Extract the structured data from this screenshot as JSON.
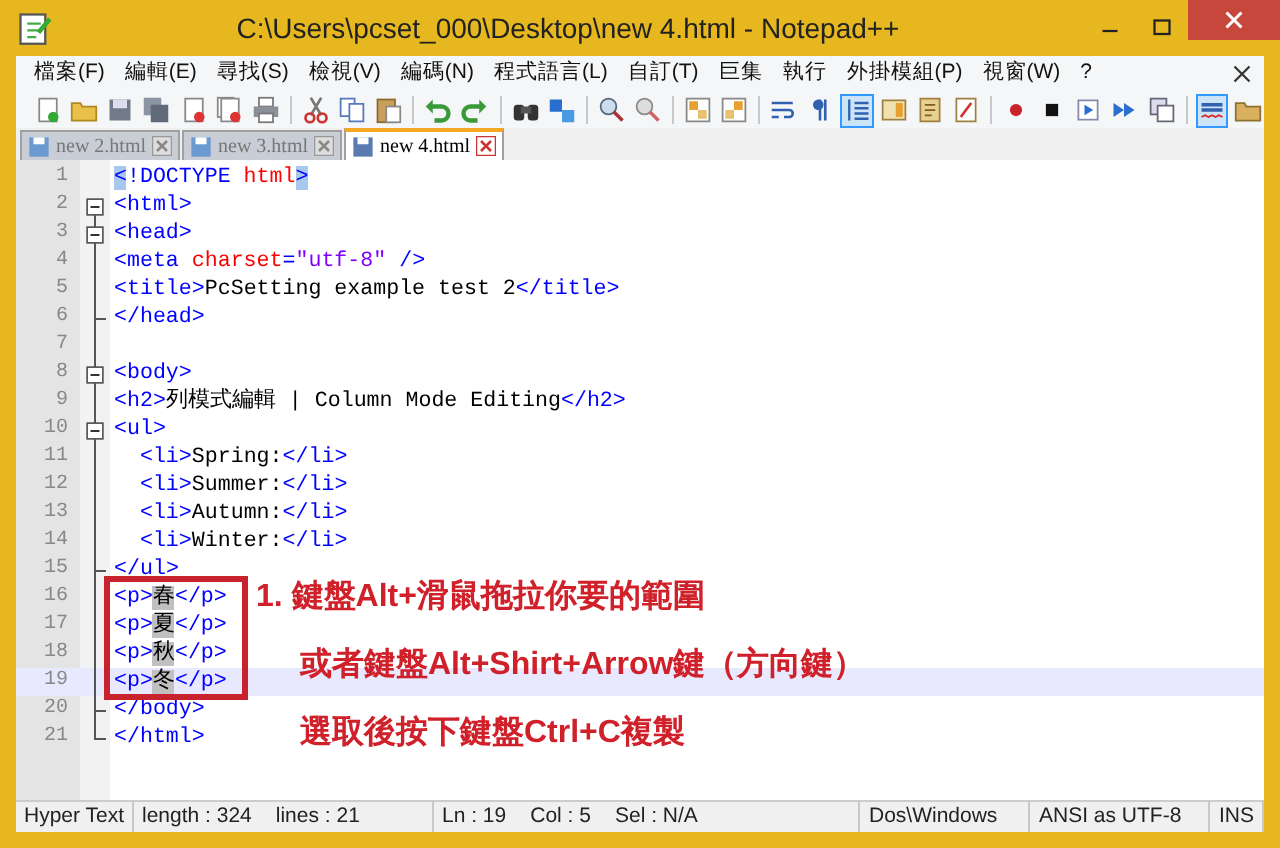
{
  "window": {
    "title": "C:\\Users\\pcset_000\\Desktop\\new  4.html - Notepad++"
  },
  "menu": [
    "檔案(F)",
    "編輯(E)",
    "尋找(S)",
    "檢視(V)",
    "編碼(N)",
    "程式語言(L)",
    "自訂(T)",
    "巨集",
    "執行",
    "外掛模組(P)",
    "視窗(W)",
    "?"
  ],
  "toolbar": [
    {
      "kind": "new",
      "pressed": false
    },
    {
      "kind": "open",
      "pressed": false
    },
    {
      "kind": "save",
      "pressed": false
    },
    {
      "kind": "saveall",
      "pressed": false
    },
    {
      "kind": "close",
      "pressed": false
    },
    {
      "kind": "closeall",
      "pressed": false
    },
    {
      "kind": "print",
      "pressed": false
    },
    {
      "kind": "sep"
    },
    {
      "kind": "cut",
      "pressed": false
    },
    {
      "kind": "copy",
      "pressed": false
    },
    {
      "kind": "paste",
      "pressed": false
    },
    {
      "kind": "sep"
    },
    {
      "kind": "undo",
      "pressed": false
    },
    {
      "kind": "redo",
      "pressed": false
    },
    {
      "kind": "sep"
    },
    {
      "kind": "find",
      "pressed": false
    },
    {
      "kind": "replace",
      "pressed": false
    },
    {
      "kind": "sep"
    },
    {
      "kind": "zoomin",
      "pressed": false
    },
    {
      "kind": "zoomout",
      "pressed": false
    },
    {
      "kind": "sep"
    },
    {
      "kind": "syncv",
      "pressed": false
    },
    {
      "kind": "synch",
      "pressed": false
    },
    {
      "kind": "sep"
    },
    {
      "kind": "wrap",
      "pressed": false
    },
    {
      "kind": "para",
      "pressed": false
    },
    {
      "kind": "indent",
      "pressed": true
    },
    {
      "kind": "docmap",
      "pressed": false
    },
    {
      "kind": "udl",
      "pressed": false
    },
    {
      "kind": "funclist",
      "pressed": false
    },
    {
      "kind": "sep"
    },
    {
      "kind": "record",
      "pressed": false
    },
    {
      "kind": "stop",
      "pressed": false
    },
    {
      "kind": "play",
      "pressed": false
    },
    {
      "kind": "playmulti",
      "pressed": false
    },
    {
      "kind": "savemacro",
      "pressed": false
    },
    {
      "kind": "sep"
    },
    {
      "kind": "spell",
      "pressed": true
    },
    {
      "kind": "folder",
      "pressed": false
    }
  ],
  "tabs": [
    {
      "label": "new  2.html",
      "selected": false
    },
    {
      "label": "new  3.html",
      "selected": false
    },
    {
      "label": "new  4.html",
      "selected": true
    }
  ],
  "lines": [
    {
      "number": "1",
      "text": "<!DOCTYPE html>",
      "brace_match": true,
      "fold_start": false,
      "fold_end": false,
      "current": false
    },
    {
      "number": "2",
      "text": "<html>",
      "fold_start": true,
      "fold_end": false,
      "current": false
    },
    {
      "number": "3",
      "text": "<head>",
      "fold_start": true,
      "fold_end": false,
      "current": false
    },
    {
      "number": "4",
      "text": "<meta charset=\"utf-8\" />",
      "fold_start": false,
      "fold_end": false,
      "current": false
    },
    {
      "number": "5",
      "text": "<title>PcSetting example test 2</title>",
      "fold_start": false,
      "fold_end": false,
      "current": false
    },
    {
      "number": "6",
      "text": "</head>",
      "fold_start": false,
      "fold_end": true,
      "current": false
    },
    {
      "number": "7",
      "fold_start": false,
      "fold_end": false,
      "current": false
    },
    {
      "number": "8",
      "text": "<body>",
      "fold_start": true,
      "fold_end": false,
      "current": false
    },
    {
      "number": "9",
      "text": "<h2>列模式編輯 | Column Mode Editing</h2>",
      "fold_start": false,
      "fold_end": false,
      "current": false
    },
    {
      "number": "10",
      "text": "<ul>",
      "fold_start": true,
      "fold_end": false,
      "current": false
    },
    {
      "number": "11",
      "text": "  <li>Spring:</li>",
      "fold_start": false,
      "fold_end": false,
      "current": false
    },
    {
      "number": "12",
      "text": "  <li>Summer:</li>",
      "fold_start": false,
      "fold_end": false,
      "current": false
    },
    {
      "number": "13",
      "text": "  <li>Autumn:</li>",
      "fold_start": false,
      "fold_end": false,
      "current": false
    },
    {
      "number": "14",
      "text": "  <li>Winter:</li>",
      "fold_start": false,
      "fold_end": false,
      "current": false
    },
    {
      "number": "15",
      "text": "</ul>",
      "fold_start": false,
      "fold_end": true,
      "current": false
    },
    {
      "number": "16",
      "text": "<p>",
      "selection": "春",
      "rest": "</p>",
      "fold_start": false,
      "fold_end": false,
      "current": false
    },
    {
      "number": "17",
      "text": "<p>",
      "selection": "夏",
      "rest": "</p>",
      "fold_start": false,
      "fold_end": false,
      "current": false
    },
    {
      "number": "18",
      "text": "<p>",
      "selection": "秋",
      "rest": "</p>",
      "fold_start": false,
      "fold_end": false,
      "current": false
    },
    {
      "number": "19",
      "text": "<p>",
      "selection": "冬",
      "rest": "</p>",
      "fold_start": false,
      "fold_end": false,
      "current": true
    },
    {
      "number": "20",
      "text": "</body>",
      "fold_start": false,
      "fold_end": true,
      "current": false
    },
    {
      "number": "21",
      "text": "</html>",
      "fold_start": false,
      "fold_end": true,
      "current": false
    }
  ],
  "annotation": [
    "1. 鍵盤Alt+滑鼠拖拉你要的範圍",
    "或者鍵盤Alt+Shirt+Arrow鍵（方向鍵）",
    "選取後按下鍵盤Ctrl+C複製"
  ],
  "status_bar": [
    [
      "Hyper Text"
    ],
    [
      "length : 324",
      "lines : 21"
    ],
    [
      "Ln : 19",
      "Col : 5",
      "Sel : N/A"
    ],
    [
      "Dos\\Windows"
    ],
    [
      "ANSI as UTF-8"
    ],
    [
      "INS"
    ]
  ]
}
